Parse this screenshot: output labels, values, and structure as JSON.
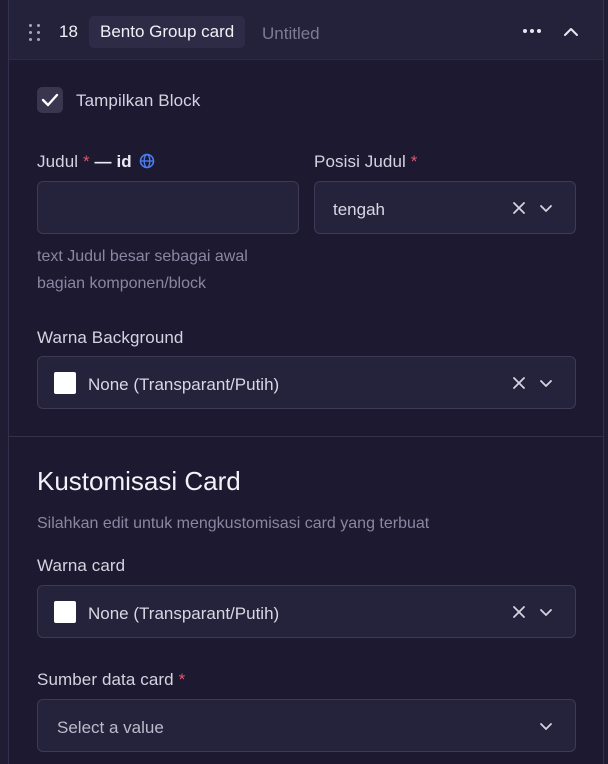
{
  "header": {
    "number": "18",
    "title": "Bento Group card",
    "subtitle": "Untitled"
  },
  "show_block": {
    "label": "Tampilkan Block",
    "checked": true
  },
  "judul": {
    "label": "Judul",
    "required_mark": "*",
    "locale": "— id",
    "value": "",
    "help_line1": "text Judul besar sebagai awal",
    "help_line2": "bagian komponen/block"
  },
  "posisi_judul": {
    "label": "Posisi Judul",
    "required_mark": "*",
    "value": "tengah"
  },
  "warna_background": {
    "label": "Warna Background",
    "value": "None (Transparant/Putih)",
    "swatch_color": "#ffffff"
  },
  "kustomisasi": {
    "heading": "Kustomisasi Card",
    "description": "Silahkan edit untuk mengkustomisasi card yang terbuat"
  },
  "warna_card": {
    "label": "Warna card",
    "value": "None (Transparant/Putih)",
    "swatch_color": "#ffffff"
  },
  "sumber_data": {
    "label": "Sumber data card",
    "required_mark": "*",
    "placeholder": "Select a value"
  },
  "colors": {
    "background": "#1c1931",
    "header": "#24213a",
    "input": "#25223b",
    "required": "#e0566a",
    "globe": "#4d7bf0"
  }
}
